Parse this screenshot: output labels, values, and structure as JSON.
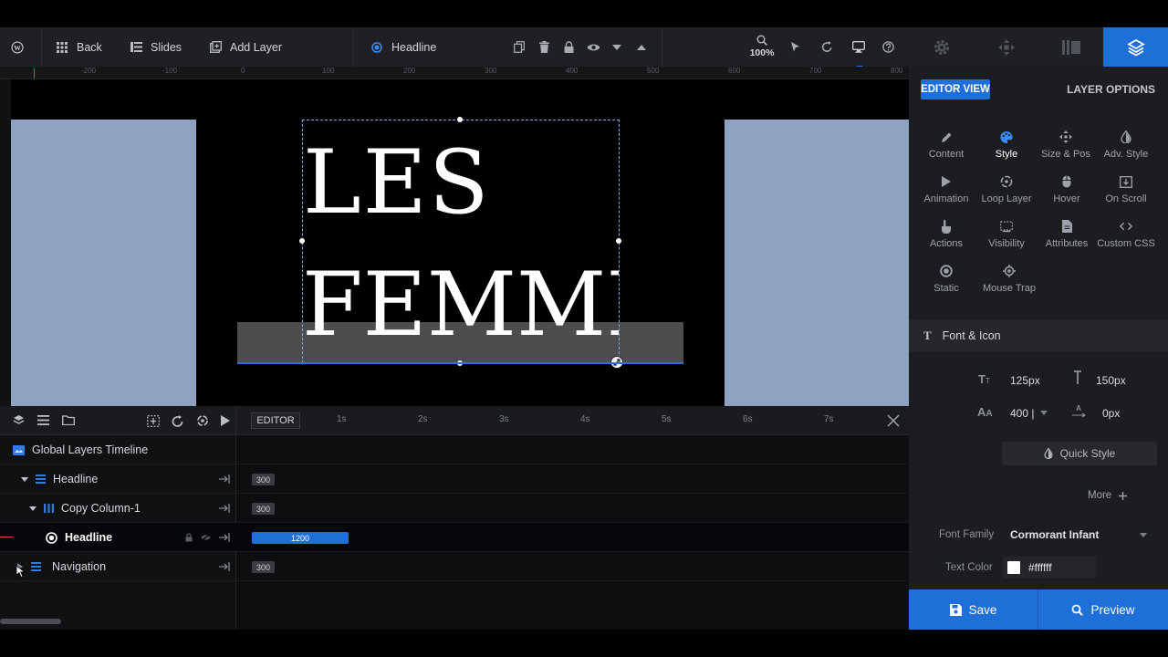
{
  "toolbar": {
    "back_label": "Back",
    "slides_label": "Slides",
    "add_layer_label": "Add Layer",
    "current_layer_label": "Headline",
    "zoom_label": "100%"
  },
  "ruler": {
    "ticks": [
      "-200",
      "-100",
      "0",
      "100",
      "200",
      "300",
      "400",
      "500",
      "600",
      "700",
      "800"
    ]
  },
  "canvas": {
    "headline_line1": "LES",
    "headline_line2": "FEMME"
  },
  "timeline": {
    "editor_label": "EDITOR",
    "time_markers": [
      "1s",
      "2s",
      "3s",
      "4s",
      "5s",
      "6s",
      "7s"
    ],
    "global_label": "Global Layers Timeline",
    "rows": [
      {
        "label": "Headline",
        "duration": "300"
      },
      {
        "label": "Copy Column-1",
        "duration": "300"
      },
      {
        "label": "Headline",
        "duration": "1200"
      },
      {
        "label": "Navigation",
        "duration": "300"
      }
    ]
  },
  "panel": {
    "editor_view_label": "EDITOR VIEW",
    "layer_options_label": "LAYER OPTIONS",
    "options": [
      {
        "label": "Content",
        "icon": "pencil-icon"
      },
      {
        "label": "Style",
        "icon": "palette-icon"
      },
      {
        "label": "Size & Pos",
        "icon": "move-icon"
      },
      {
        "label": "Adv. Style",
        "icon": "contrast-icon"
      },
      {
        "label": "Animation",
        "icon": "play-icon"
      },
      {
        "label": "Loop Layer",
        "icon": "loop-icon"
      },
      {
        "label": "Hover",
        "icon": "mouse-icon"
      },
      {
        "label": "On Scroll",
        "icon": "scroll-icon"
      },
      {
        "label": "Actions",
        "icon": "hand-icon"
      },
      {
        "label": "Visibility",
        "icon": "visibility-icon"
      },
      {
        "label": "Attributes",
        "icon": "file-icon"
      },
      {
        "label": "Custom CSS",
        "icon": "code-icon"
      },
      {
        "label": "Static",
        "icon": "circle-icon"
      },
      {
        "label": "Mouse Trap",
        "icon": "target-icon"
      }
    ],
    "font_section_label": "Font & Icon",
    "font_size": "125px",
    "line_height": "150px",
    "font_weight": "400 |",
    "letter_spacing": "0px",
    "quick_style_label": "Quick Style",
    "more_label": "More",
    "font_family_label": "Font Family",
    "font_family_value": "Cormorant Infant",
    "text_color_label": "Text Color",
    "text_color_value": "#ffffff"
  },
  "actions": {
    "save_label": "Save",
    "preview_label": "Preview"
  },
  "colors": {
    "accent": "#1f6fd9",
    "canvas_side_blocks": "#8fa3c0"
  }
}
